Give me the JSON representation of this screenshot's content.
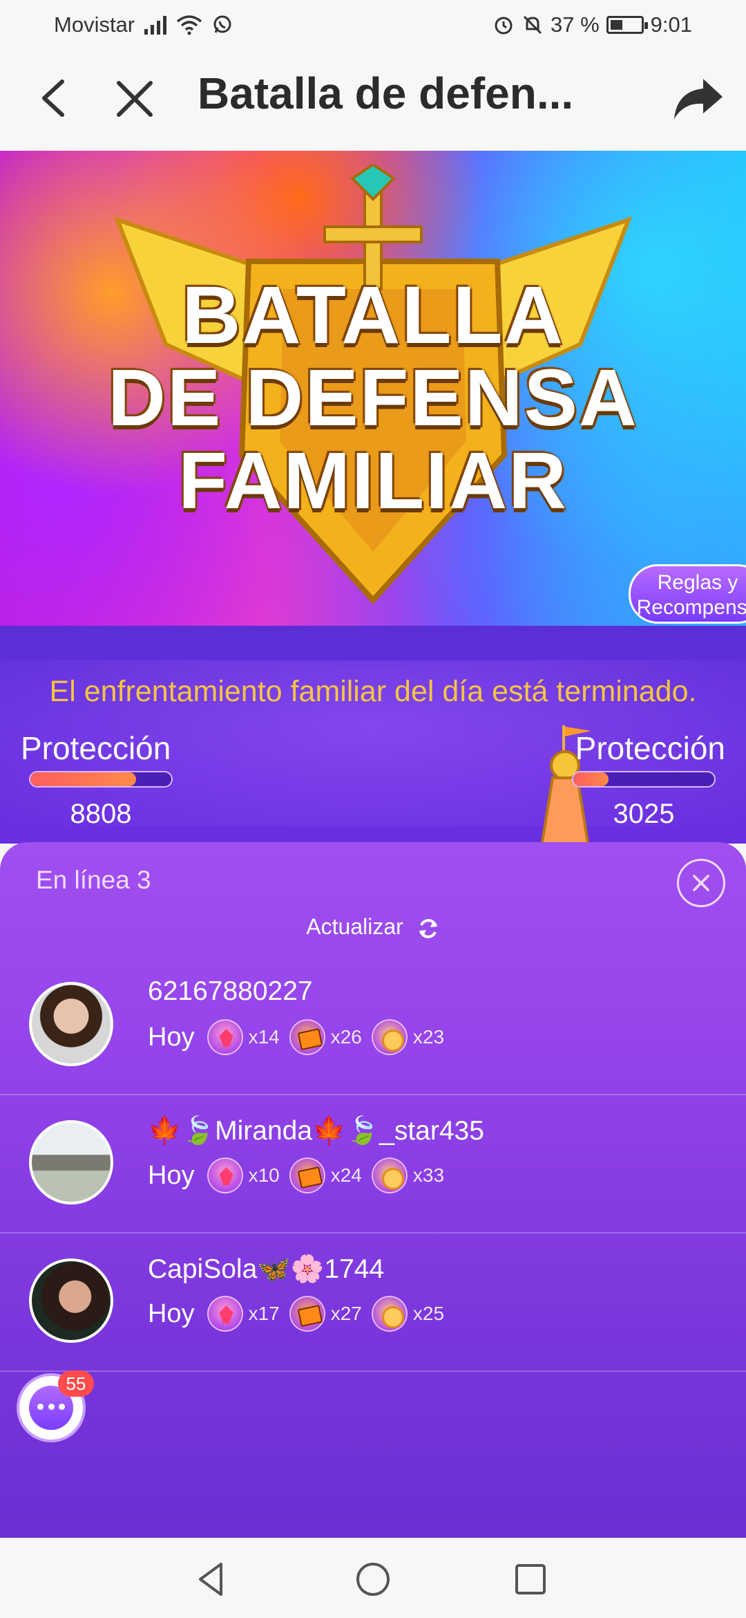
{
  "status_bar": {
    "carrier": "Movistar",
    "battery": "37 %",
    "time": "9:01"
  },
  "header": {
    "title": "Batalla de defen..."
  },
  "banner": {
    "line1": "BATALLA",
    "line2": "DE DEFENSA",
    "line3": "FAMILIAR",
    "rules_line1": "Reglas y",
    "rules_line2": "Recompensa"
  },
  "battle": {
    "message": "El enfrentamiento familiar del día está terminado.",
    "left": {
      "label": "Protección",
      "score": "8808",
      "bar_fill": 0.75
    },
    "right": {
      "label": "Protección",
      "score": "3025",
      "bar_fill": 0.25
    }
  },
  "online": {
    "title": "En línea 3",
    "refresh": "Actualizar",
    "users": [
      {
        "name": "62167880227",
        "day": "Hoy",
        "crystals": "x14",
        "books": "x26",
        "balls": "x23",
        "avatar_color": "#c9a28c"
      },
      {
        "name": "🍁🍃Miranda🍁🍃_star435",
        "day": "Hoy",
        "crystals": "x10",
        "books": "x24",
        "balls": "x33",
        "avatar_color": "#8c9a8a"
      },
      {
        "name": "CapiSola🦋🌸1744",
        "day": "Hoy",
        "crystals": "x17",
        "books": "x27",
        "balls": "x25",
        "avatar_color": "#7a5a50"
      }
    ],
    "chat_badge": "55"
  },
  "colors": {
    "accent": "#9444ea",
    "message_yellow": "#f4c542",
    "badge_red": "#ff4b4b"
  }
}
